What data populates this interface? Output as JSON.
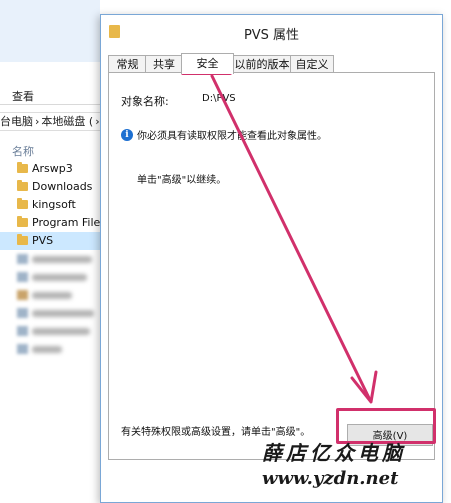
{
  "explorer": {
    "ribbon_tab": "查看",
    "breadcrumb": [
      "台电脑",
      "›",
      "本地磁盘 (",
      "›"
    ],
    "column_header": "名称",
    "folders": [
      {
        "label": "Arswp3",
        "selected": false
      },
      {
        "label": "Downloads",
        "selected": false
      },
      {
        "label": "kingsoft",
        "selected": false
      },
      {
        "label": "Program Files",
        "selected": false
      },
      {
        "label": "PVS",
        "selected": true
      }
    ]
  },
  "dialog": {
    "title": "PVS 属性",
    "tabs": [
      "常规",
      "共享",
      "安全",
      "以前的版本",
      "自定义"
    ],
    "active_tab": "安全",
    "object_label": "对象名称:",
    "object_value": "D:\\PVS",
    "info_message": "你必须具有读取权限才能查看此对象属性。",
    "info_sub": "单击\"高级\"以继续。",
    "special_permissions_text": "有关特殊权限或高级设置，请单击\"高级\"。",
    "advanced_button": "高级(V)"
  },
  "annotation": {
    "color": "#d1306b"
  },
  "watermark": {
    "cn": "薛店亿众电脑",
    "url": "www.yzdn.net"
  }
}
